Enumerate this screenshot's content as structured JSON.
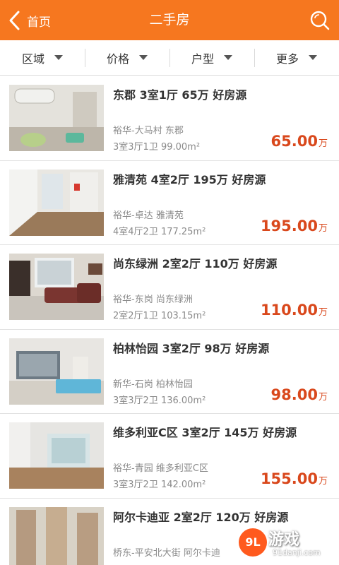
{
  "header": {
    "back_label": "首页",
    "title": "二手房"
  },
  "filters": [
    {
      "label": "区域"
    },
    {
      "label": "价格"
    },
    {
      "label": "户型"
    },
    {
      "label": "更多"
    }
  ],
  "listings": [
    {
      "title": "东郡 3室1厅 65万 好房源",
      "location": "裕华-大马村  东郡",
      "spec": "3室3厅1卫  99.00m²",
      "price": "65.00",
      "unit": "万"
    },
    {
      "title": "雅清苑 4室2厅 195万 好房源",
      "location": "裕华-卓达  雅清苑",
      "spec": "4室4厅2卫  177.25m²",
      "price": "195.00",
      "unit": "万"
    },
    {
      "title": "尚东绿洲 2室2厅 110万 好房源",
      "location": "裕华-东岗  尚东绿洲",
      "spec": "2室2厅1卫  103.15m²",
      "price": "110.00",
      "unit": "万"
    },
    {
      "title": "柏林怡园 3室2厅 98万 好房源",
      "location": "新华-石岗  柏林怡园",
      "spec": "3室3厅2卫  136.00m²",
      "price": "98.00",
      "unit": "万"
    },
    {
      "title": "维多利亚C区 3室2厅 145万 好房源",
      "location": "裕华-青园  维多利亚C区",
      "spec": "3室3厅2卫  142.00m²",
      "price": "155.00",
      "unit": "万"
    },
    {
      "title": "阿尔卡迪亚 2室2厅 120万 好房源",
      "location": "桥东-平安北大街  阿尔卡迪",
      "spec": "",
      "price": "",
      "unit": ""
    }
  ],
  "watermark": {
    "logo": "9L",
    "text": "游戏",
    "url": "91danji.com"
  },
  "colors": {
    "accent": "#f6771f",
    "price": "#d9481c"
  }
}
